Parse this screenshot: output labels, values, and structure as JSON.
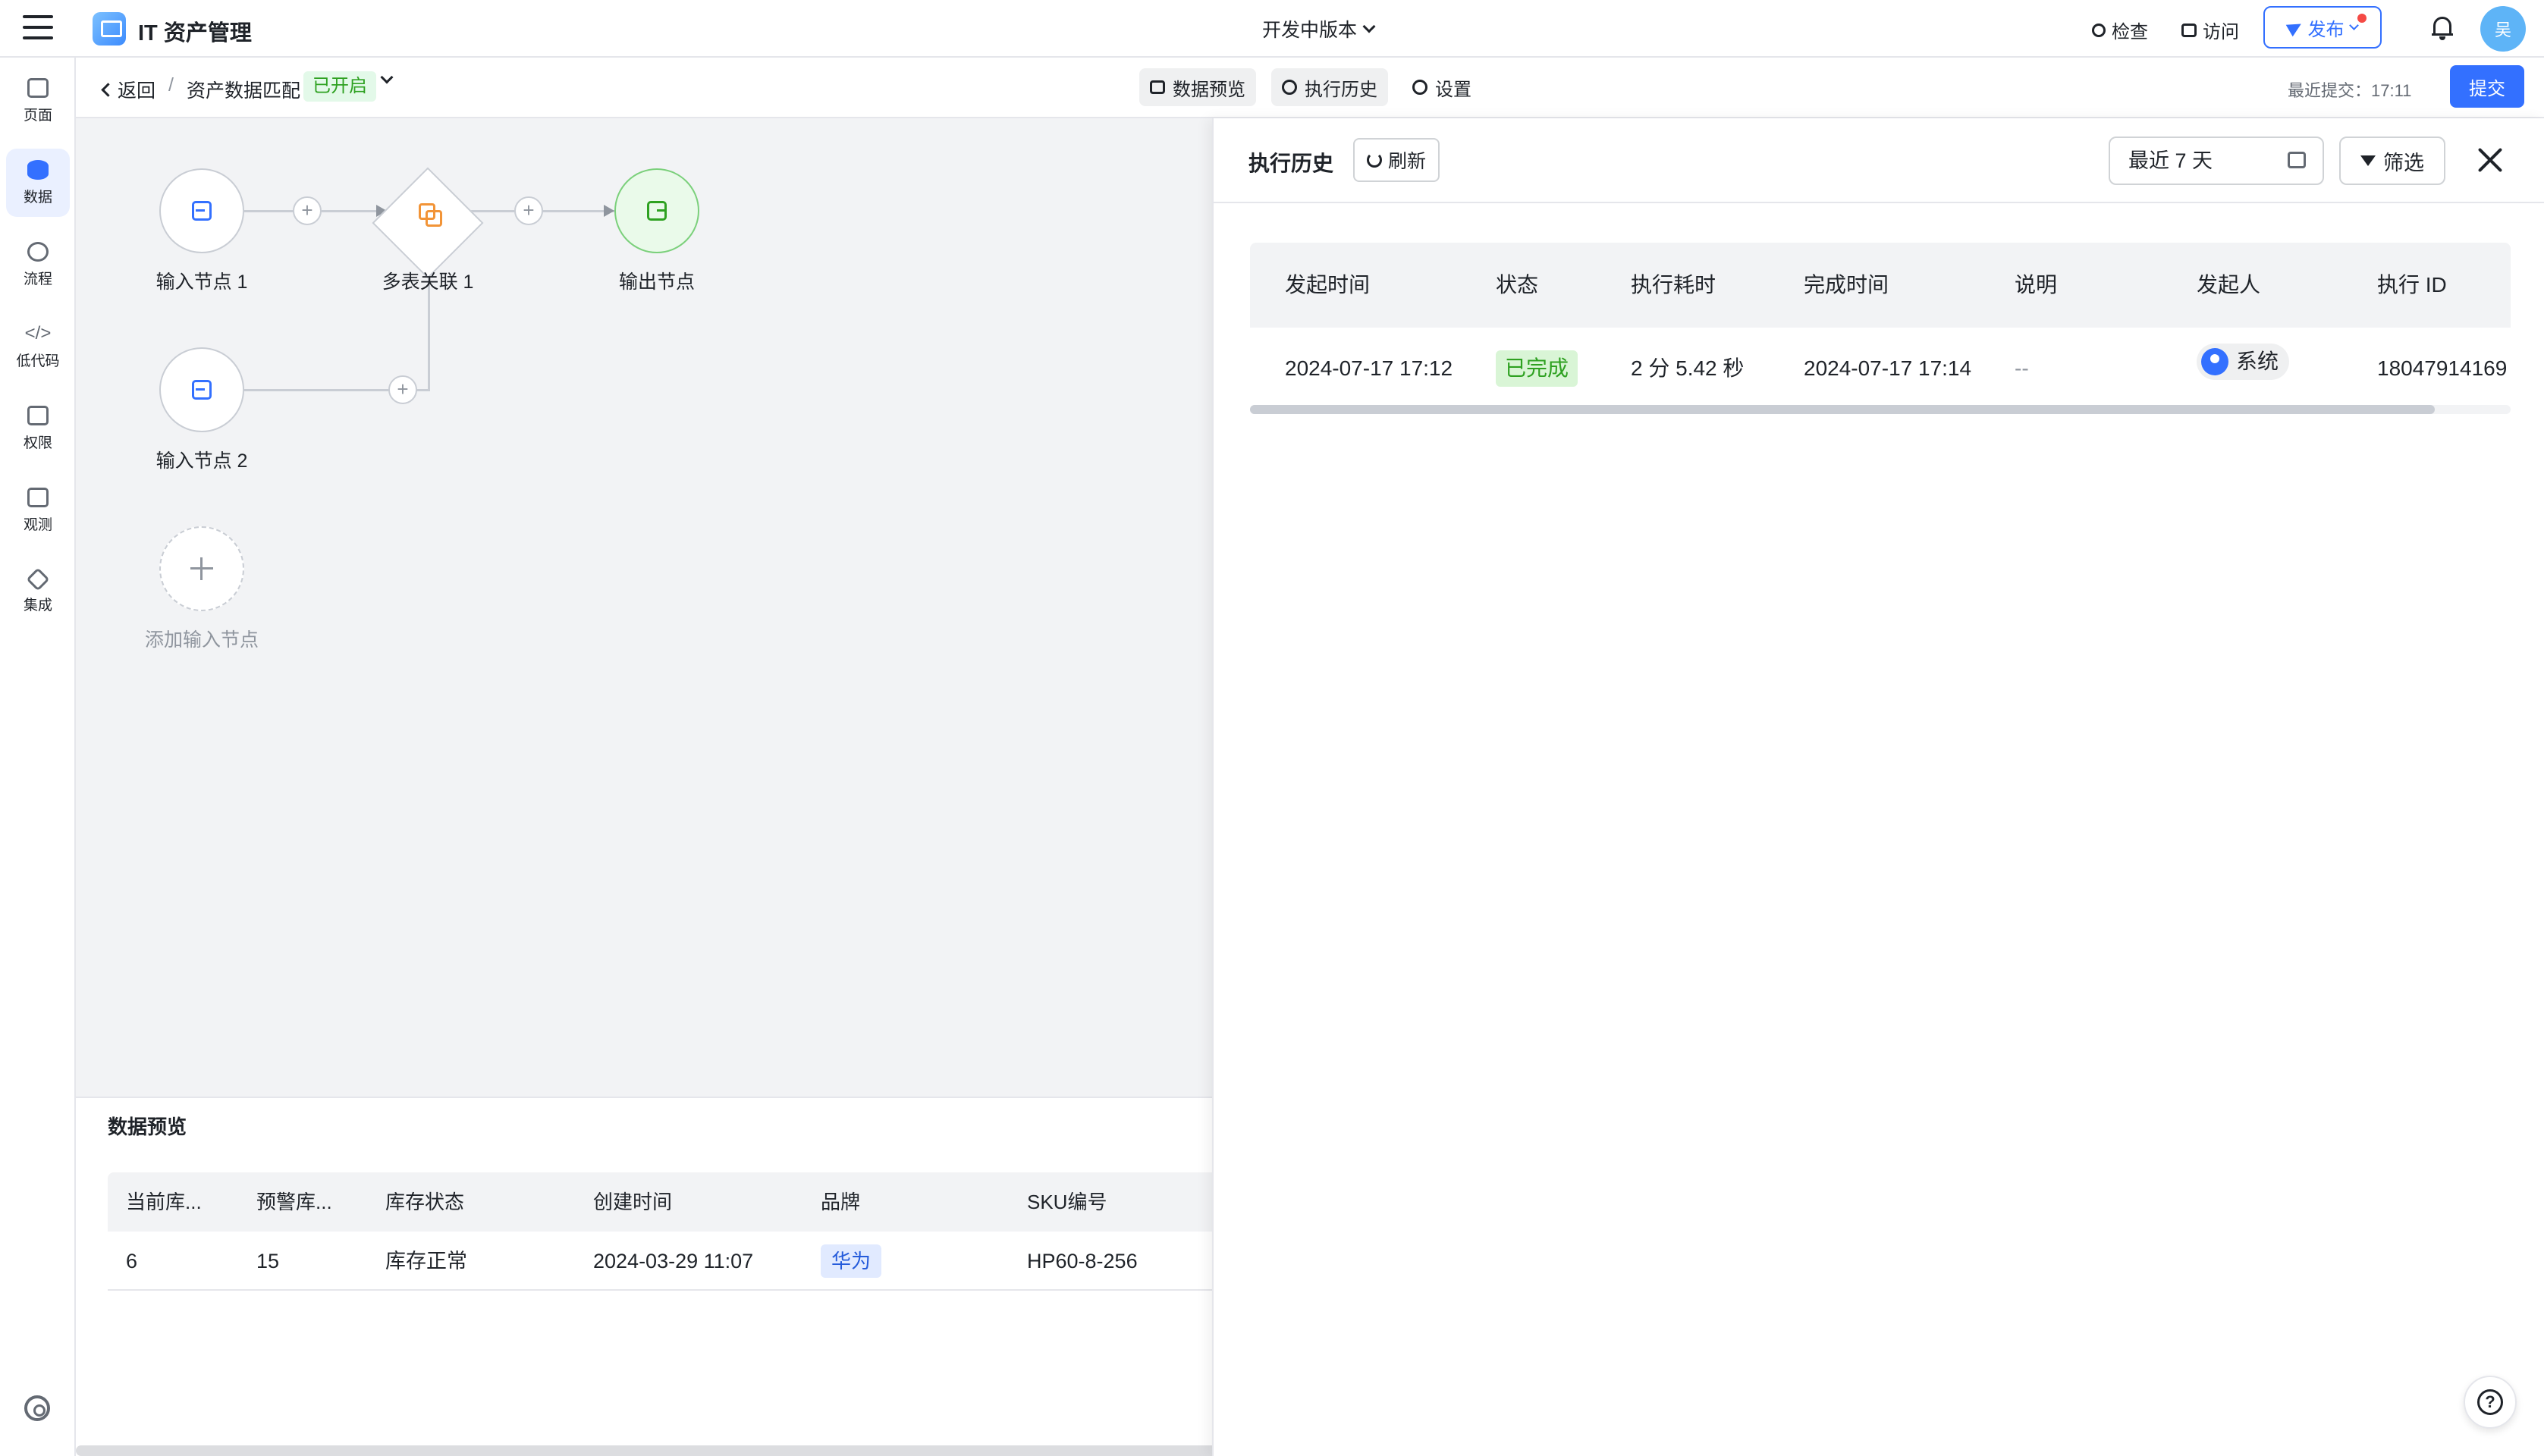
{
  "app": {
    "title": "IT 资产管理",
    "version_label": "开发中版本"
  },
  "topbar": {
    "inspect": "检查",
    "visit": "访问",
    "publish": "发布",
    "avatar_text": "吴"
  },
  "rail": {
    "items": [
      {
        "label": "页面",
        "icon": "page-icon"
      },
      {
        "label": "数据",
        "icon": "database-icon",
        "active": true
      },
      {
        "label": "流程",
        "icon": "flow-icon"
      },
      {
        "label": "低代码",
        "icon": "code-icon"
      },
      {
        "label": "权限",
        "icon": "lock-icon"
      },
      {
        "label": "观测",
        "icon": "monitor-icon"
      },
      {
        "label": "集成",
        "icon": "cube-icon"
      }
    ]
  },
  "subheader": {
    "back": "返回",
    "separator": "/",
    "breadcrumb": "资产数据匹配",
    "status": "已开启",
    "tabs": {
      "preview": "数据预览",
      "history": "执行历史",
      "settings": "设置"
    },
    "last_submit": "最近提交：17:11",
    "submit": "提交"
  },
  "canvas": {
    "nodes": {
      "input1": "输入节点 1",
      "join": "多表关联 1",
      "output": "输出节点",
      "input2": "输入节点 2",
      "add_input": "添加输入节点"
    }
  },
  "preview": {
    "title": "数据预览",
    "columns": [
      "当前库...",
      "预警库...",
      "库存状态",
      "创建时间",
      "品牌",
      "SKU编号"
    ],
    "rows": [
      {
        "current": "6",
        "warning": "15",
        "status": "库存正常",
        "created": "2024-03-29 11:07",
        "brand": "华为",
        "sku": "HP60-8-256"
      }
    ]
  },
  "history": {
    "title": "执行历史",
    "refresh": "刷新",
    "date_range": "最近 7 天",
    "filter": "筛选",
    "columns": [
      "发起时间",
      "状态",
      "执行耗时",
      "完成时间",
      "说明",
      "发起人",
      "执行 ID"
    ],
    "rows": [
      {
        "start": "2024-07-17 17:12",
        "status": "已完成",
        "duration": "2 分 5.42 秒",
        "end": "2024-07-17 17:14",
        "note": "--",
        "initiator": "系统",
        "exec_id": "18047914169"
      }
    ]
  },
  "colors": {
    "accent": "#3370ff",
    "success": "#2ea121",
    "canvas_bg": "#f2f3f5"
  }
}
